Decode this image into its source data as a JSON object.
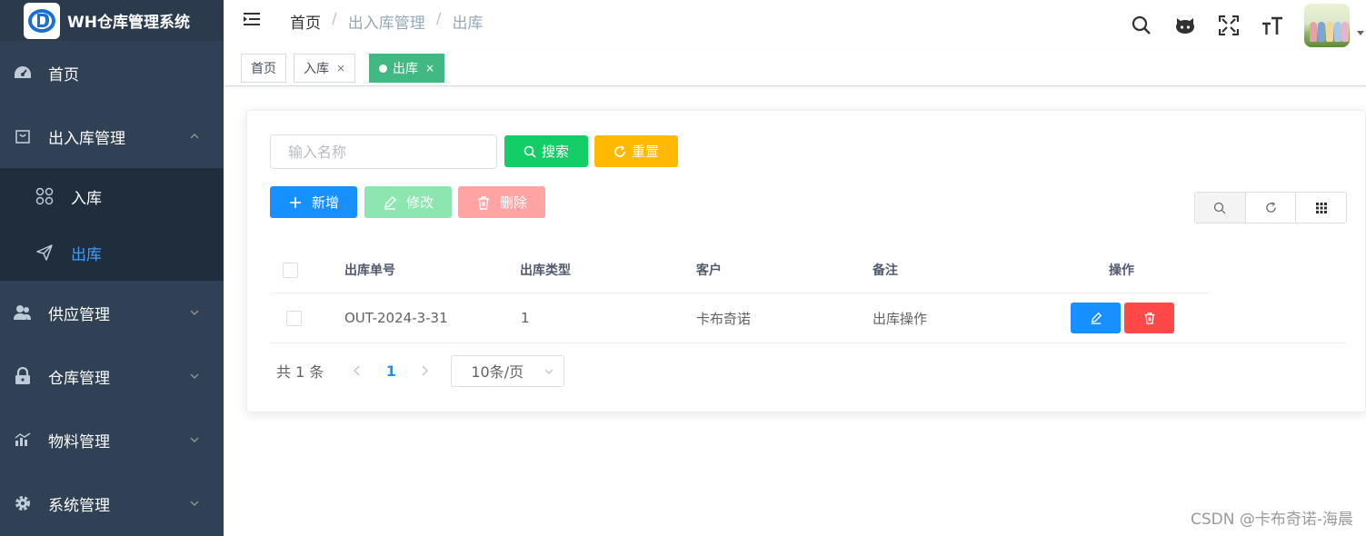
{
  "app": {
    "title": "WH仓库管理系统"
  },
  "sidebar": {
    "items": [
      {
        "label": "首页"
      },
      {
        "label": "出入库管理"
      },
      {
        "label": "供应管理"
      },
      {
        "label": "仓库管理"
      },
      {
        "label": "物料管理"
      },
      {
        "label": "系统管理"
      }
    ],
    "sub_items": [
      {
        "label": "入库"
      },
      {
        "label": "出库"
      }
    ]
  },
  "breadcrumb": {
    "home": "首页",
    "section": "出入库管理",
    "current": "出库",
    "separator": "/"
  },
  "tags": [
    {
      "label": "首页"
    },
    {
      "label": "入库",
      "close": "×"
    },
    {
      "label": "出库",
      "close": "×"
    }
  ],
  "search": {
    "placeholder": "输入名称",
    "search_label": "搜索",
    "reset_label": "重置"
  },
  "toolbar": {
    "add_label": "新增",
    "edit_label": "修改",
    "delete_label": "删除"
  },
  "table": {
    "columns": [
      "出库单号",
      "出库类型",
      "客户",
      "备注",
      "操作"
    ],
    "rows": [
      {
        "order_no": "OUT-2024-3-31",
        "type": "1",
        "customer": "卡布奇诺",
        "remark": "出库操作"
      }
    ]
  },
  "pagination": {
    "total_text": "共 1 条",
    "current_page": "1",
    "page_size": "10条/页"
  },
  "watermark": "CSDN @卡布奇诺-海晨",
  "colors": {
    "sidebar_bg": "#304156",
    "active_tag": "#42b983",
    "primary": "#1890ff",
    "success": "#13ce66",
    "warning": "#ffba00",
    "danger": "#ff4949"
  }
}
